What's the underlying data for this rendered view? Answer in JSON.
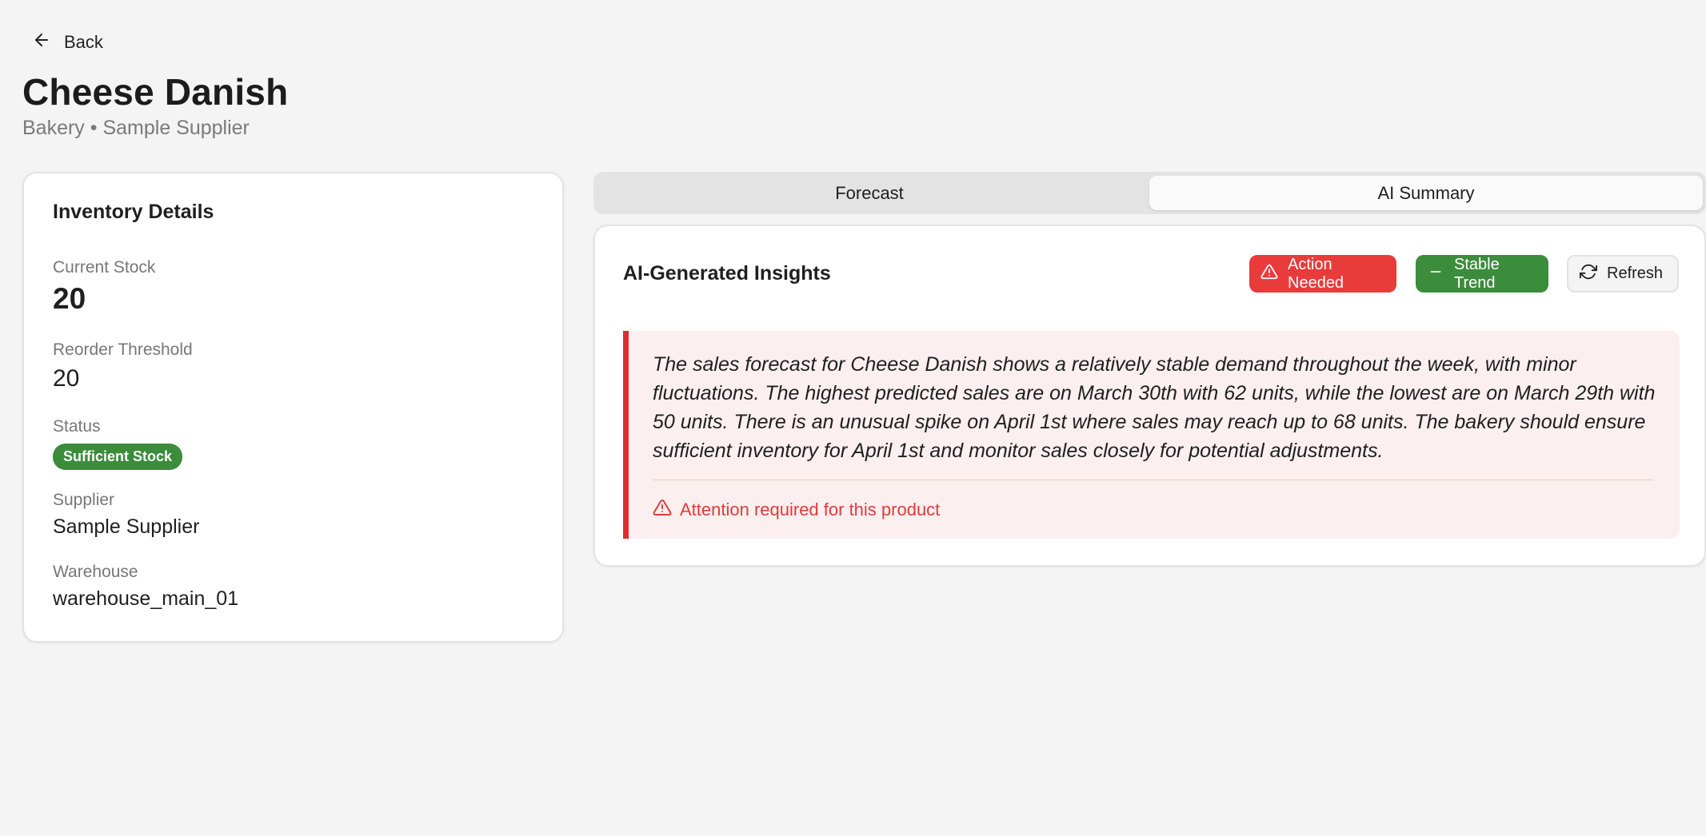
{
  "header": {
    "back_label": "Back",
    "title": "Cheese Danish",
    "subtitle": "Bakery • Sample Supplier"
  },
  "inventory": {
    "title": "Inventory Details",
    "current_stock_label": "Current Stock",
    "current_stock": "20",
    "reorder_label": "Reorder Threshold",
    "reorder_threshold": "20",
    "status_label": "Status",
    "status": "Sufficient Stock",
    "supplier_label": "Supplier",
    "supplier": "Sample Supplier",
    "warehouse_label": "Warehouse",
    "warehouse": "warehouse_main_01"
  },
  "tabs": [
    {
      "label": "Forecast",
      "active": false
    },
    {
      "label": "AI Summary",
      "active": true
    }
  ],
  "insights": {
    "title": "AI-Generated Insights",
    "action_label": "Action Needed",
    "trend_label": "Stable Trend",
    "refresh_label": "Refresh",
    "summary": "The sales forecast for Cheese Danish shows a relatively stable demand throughout the week, with minor fluctuations. The highest predicted sales are on March 30th with 62 units, while the lowest are on March 29th with 50 units. There is an unusual spike on April 1st where sales may reach up to 68 units. The bakery should ensure sufficient inventory for April 1st and monitor sales closely for potential adjustments.",
    "attention": "Attention required for this product"
  },
  "colors": {
    "danger": "#ea3b3b",
    "success": "#3b8c3b",
    "alert_bg": "#fbefef",
    "alert_border": "#e02b2b",
    "page_bg": "#f4f4f4"
  },
  "icons": [
    "arrow-left-icon",
    "alert-triangle-icon",
    "minus-icon",
    "refresh-icon"
  ]
}
